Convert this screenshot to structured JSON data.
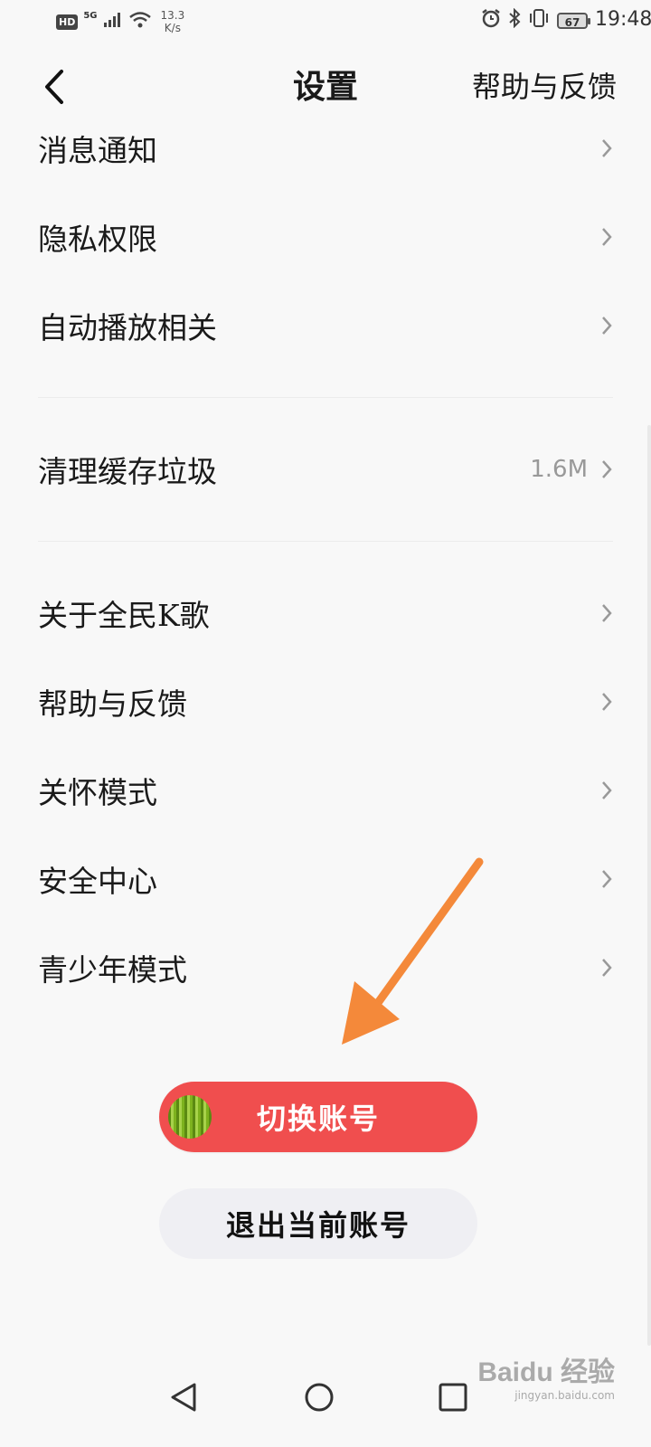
{
  "status_bar": {
    "hd": "HD",
    "network": "5G",
    "speed_value": "13.3",
    "speed_unit": "K/s",
    "battery": "67",
    "time": "19:48"
  },
  "header": {
    "title": "设置",
    "help_link": "帮助与反馈"
  },
  "settings": {
    "notifications": "消息通知",
    "privacy": "隐私权限",
    "autoplay": "自动播放相关",
    "clear_cache": "清理缓存垃圾",
    "cache_size": "1.6M",
    "about": "关于全民K歌",
    "help": "帮助与反馈",
    "care_mode": "关怀模式",
    "security": "安全中心",
    "teen_mode": "青少年模式"
  },
  "buttons": {
    "switch_account": "切换账号",
    "logout": "退出当前账号"
  },
  "watermark": {
    "main": "Baidu 经验",
    "sub": "jingyan.baidu.com"
  },
  "colors": {
    "switch_button": "#f04e4e",
    "logout_button": "#efeff3",
    "annotation_arrow": "#f4893a",
    "background": "#f8f8f8"
  }
}
